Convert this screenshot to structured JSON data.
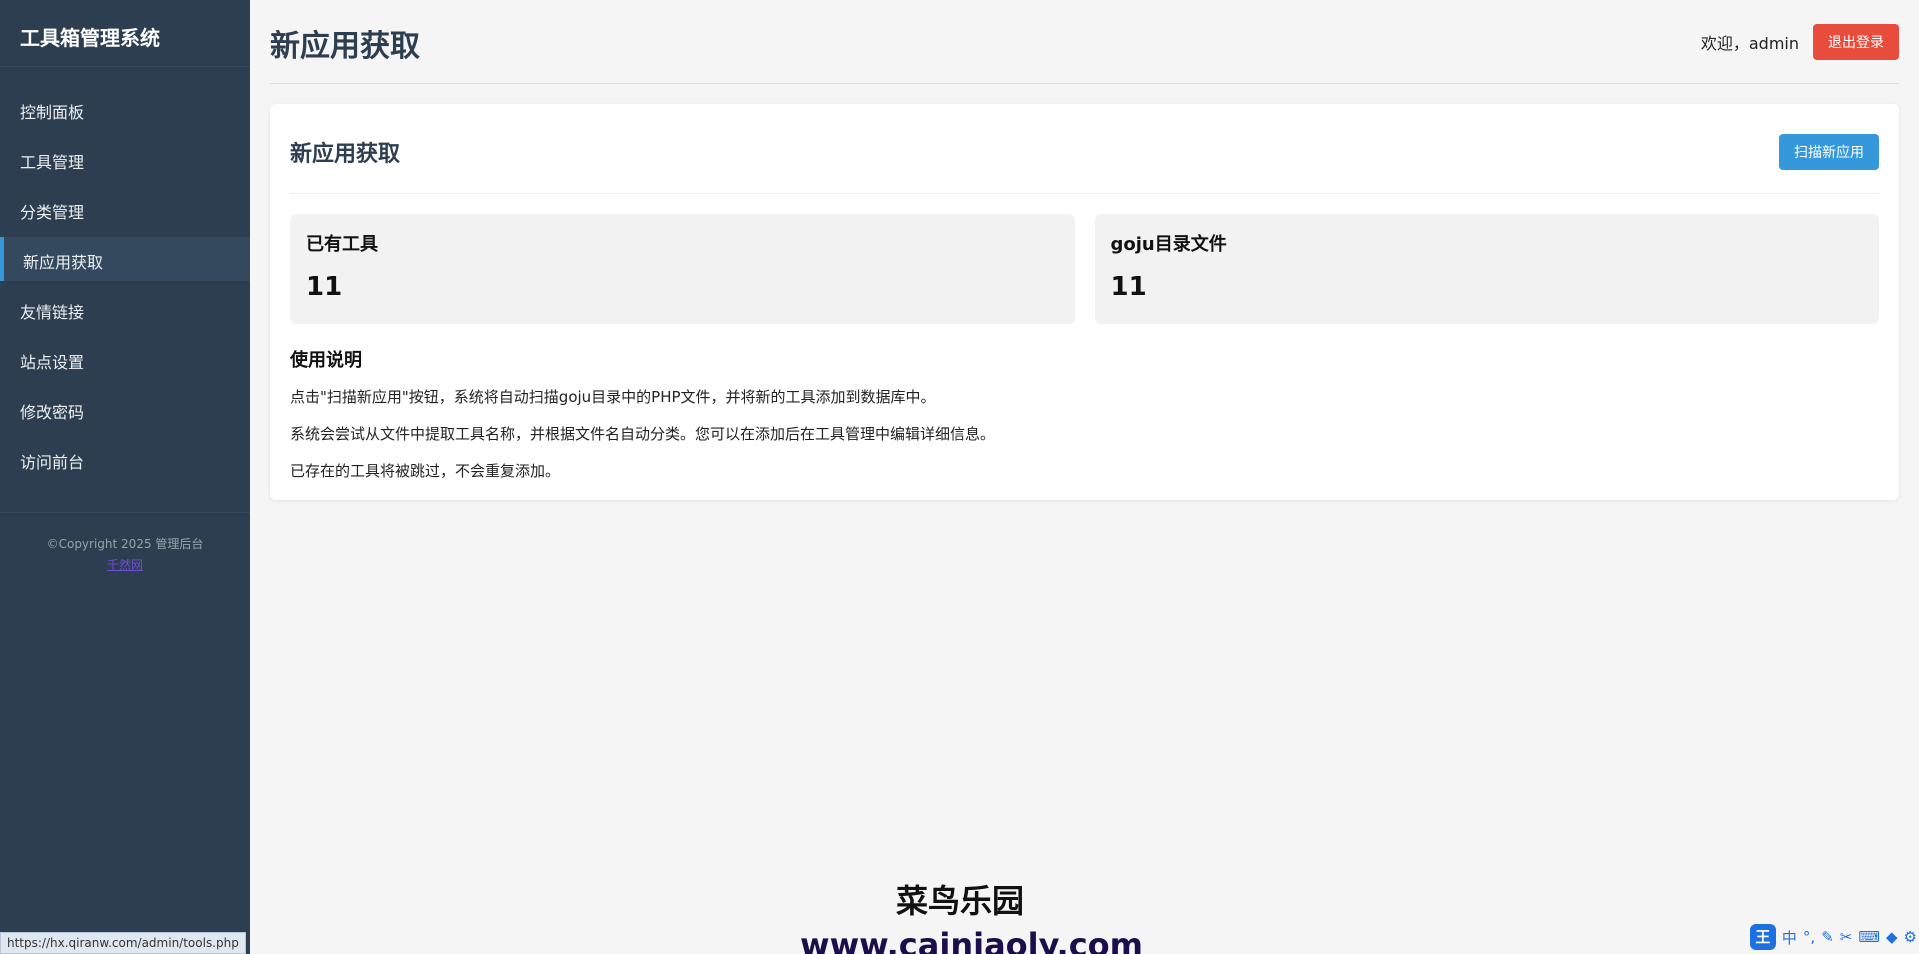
{
  "sidebar": {
    "brand": "工具箱管理系统",
    "items": [
      {
        "label": "控制面板"
      },
      {
        "label": "工具管理"
      },
      {
        "label": "分类管理"
      },
      {
        "label": "新应用获取",
        "active": true
      },
      {
        "label": "友情链接"
      },
      {
        "label": "站点设置"
      },
      {
        "label": "修改密码"
      },
      {
        "label": "访问前台"
      }
    ],
    "footer": {
      "copyright": "©Copyright 2025 管理后台",
      "link": "千然网"
    }
  },
  "header": {
    "title": "新应用获取",
    "welcome": "欢迎，admin",
    "logout_label": "退出登录"
  },
  "card": {
    "title": "新应用获取",
    "scan_label": "扫描新应用",
    "stats": [
      {
        "label": "已有工具",
        "value": "11"
      },
      {
        "label": "goju目录文件",
        "value": "11"
      }
    ],
    "instructions_title": "使用说明",
    "instructions": [
      "点击\"扫描新应用\"按钮，系统将自动扫描goju目录中的PHP文件，并将新的工具添加到数据库中。",
      "系统会尝试从文件中提取工具名称，并根据文件名自动分类。您可以在添加后在工具管理中编辑详细信息。",
      "已存在的工具将被跳过，不会重复添加。"
    ]
  },
  "status_bar": {
    "url": "https://hx.qiranw.com/admin/tools.php"
  },
  "watermark": {
    "title": "菜鸟乐园",
    "url": "www.cainiaoly.com"
  },
  "ime": {
    "logo": "王",
    "mode": "中",
    "symbols": "°,"
  },
  "colors": {
    "sidebar_bg": "#2c3e50",
    "accent": "#3498db",
    "danger": "#e74c3c"
  }
}
